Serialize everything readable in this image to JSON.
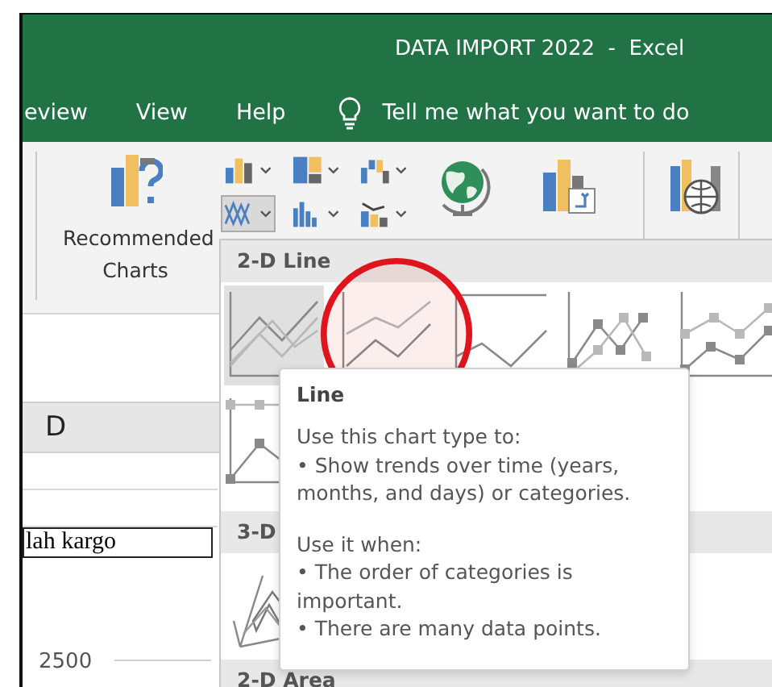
{
  "window": {
    "title": "DATA IMPORT 2022  -  Excel"
  },
  "tabs": [
    {
      "label": "eview",
      "selected": false
    },
    {
      "label": "View",
      "selected": false
    },
    {
      "label": "Help",
      "selected": false
    }
  ],
  "tell_me": {
    "placeholder": "Tell me what you want to do"
  },
  "ribbon": {
    "recommended": {
      "label": "Recommended Charts"
    },
    "chart_buttons": [
      {
        "kind": "column",
        "selected": false
      },
      {
        "kind": "hierarchy",
        "selected": false
      },
      {
        "kind": "waterfall",
        "selected": false
      },
      {
        "kind": "line",
        "selected": true
      },
      {
        "kind": "statistic",
        "selected": false
      },
      {
        "kind": "combo",
        "selected": false
      }
    ],
    "large_buttons": [
      {
        "kind": "maps"
      },
      {
        "kind": "pivot"
      },
      {
        "kind": "globe"
      }
    ]
  },
  "sheet": {
    "column_header": "D",
    "cell": "lah kargo",
    "axis_label": "2500"
  },
  "gallery": {
    "sections": [
      {
        "title": "2-D Line",
        "rows": [
          [
            {
              "kind": "line",
              "highlighted": true
            },
            {
              "kind": "stacked",
              "highlighted": false
            },
            {
              "kind": "percent",
              "highlighted": false
            },
            {
              "kind": "markers",
              "highlighted": false
            },
            {
              "kind": "stackedmarkers",
              "highlighted": false
            }
          ],
          [
            {
              "kind": "percentmarkers",
              "highlighted": false
            }
          ]
        ]
      },
      {
        "title": "3-D",
        "rows": [
          [
            {
              "kind": "perspective",
              "highlighted": false
            }
          ]
        ]
      },
      {
        "title": "2-D Area"
      }
    ]
  },
  "tooltip": {
    "title": "Line",
    "paragraphs": [
      [
        "Use this chart type to:",
        "• Show trends over time (years, months, and days) or categories."
      ],
      [
        "Use it when:",
        "• The order of categories is important.",
        "• There are many data points."
      ]
    ]
  }
}
